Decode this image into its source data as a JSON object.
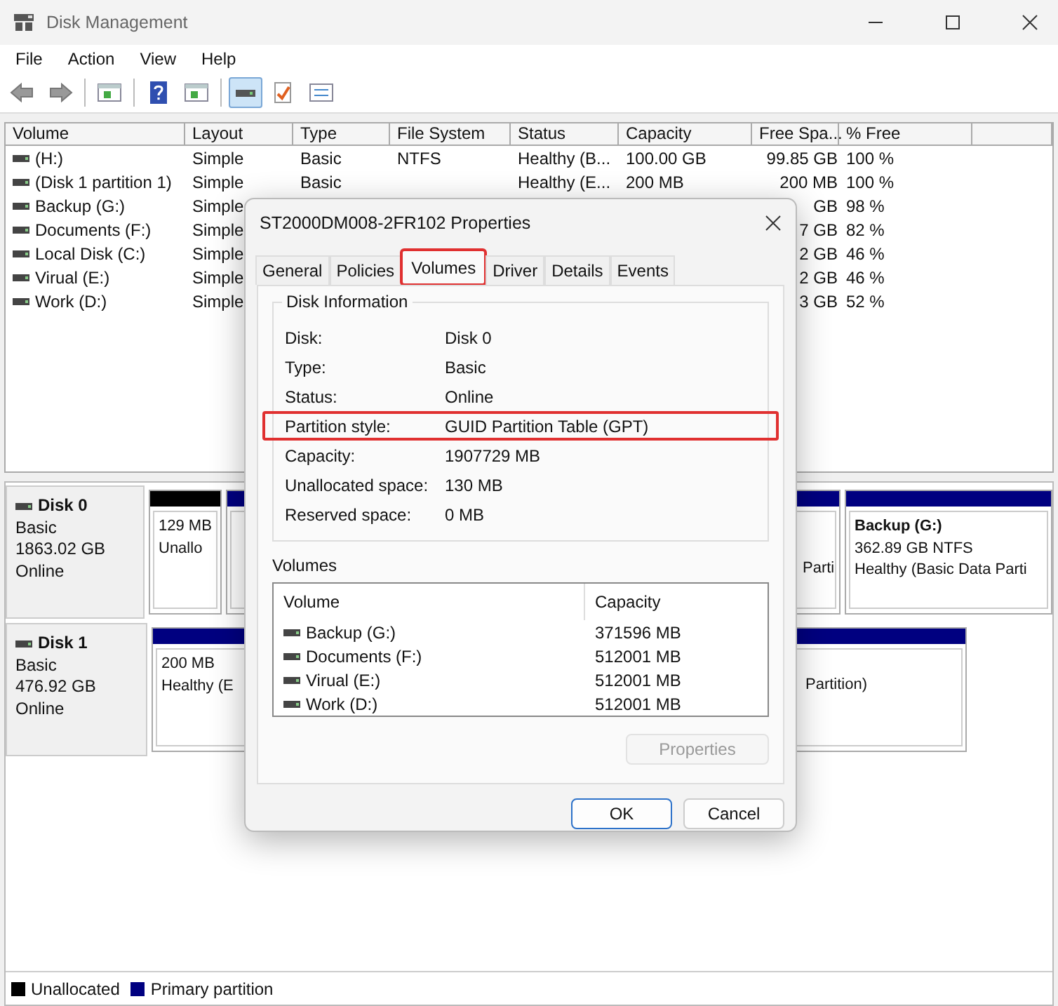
{
  "window": {
    "title": "Disk Management"
  },
  "menu": [
    "File",
    "Action",
    "View",
    "Help"
  ],
  "toolbar": [
    {
      "kind": "back",
      "selected": false
    },
    {
      "kind": "forward",
      "selected": false
    },
    {
      "kind": "sep"
    },
    {
      "kind": "pane",
      "selected": false
    },
    {
      "kind": "sep"
    },
    {
      "kind": "help",
      "selected": false
    },
    {
      "kind": "pane2",
      "selected": false
    },
    {
      "kind": "sep"
    },
    {
      "kind": "drive",
      "selected": true
    },
    {
      "kind": "check",
      "selected": false
    },
    {
      "kind": "list",
      "selected": false
    }
  ],
  "volume_table": {
    "columns": [
      "Volume",
      "Layout",
      "Type",
      "File System",
      "Status",
      "Capacity",
      "Free Spa...",
      "% Free"
    ],
    "rows": [
      {
        "cells": [
          " (H:)",
          "Simple",
          "Basic",
          "NTFS",
          "Healthy (B...",
          "100.00 GB",
          "99.85 GB",
          "100 %"
        ]
      },
      {
        "cells": [
          "(Disk 1 partition 1)",
          "Simple",
          "Basic",
          "",
          "Healthy (E...",
          "200 MB",
          "200 MB",
          "100 %"
        ]
      },
      {
        "cells": [
          "Backup (G:)",
          "Simple",
          "",
          "",
          "",
          "",
          "GB",
          "98 %"
        ]
      },
      {
        "cells": [
          "Documents (F:)",
          "Simple",
          "",
          "",
          "",
          "",
          "7 GB",
          "82 %"
        ]
      },
      {
        "cells": [
          "Local Disk (C:)",
          "Simple",
          "",
          "",
          "",
          "",
          "2 GB",
          "46 %"
        ]
      },
      {
        "cells": [
          "Virual (E:)",
          "Simple",
          "",
          "",
          "",
          "",
          "2 GB",
          "46 %"
        ]
      },
      {
        "cells": [
          "Work (D:)",
          "Simple",
          "",
          "",
          "",
          "",
          "3 GB",
          "52 %"
        ]
      }
    ]
  },
  "disks": [
    {
      "name": "Disk 0",
      "type": "Basic",
      "size": "1863.02 GB",
      "status": "Online",
      "partitions": [
        {
          "kind": "unallocated",
          "covered": false,
          "lines": [
            "129 MB",
            "Unallo"
          ]
        },
        {
          "kind": "primary",
          "covered": false
        },
        {
          "kind": "primary",
          "covered": true,
          "lines": [
            "Parti"
          ]
        },
        {
          "kind": "primary",
          "covered": false,
          "title": "Backup  (G:)",
          "lines": [
            "362.89 GB NTFS",
            "Healthy (Basic Data Parti"
          ]
        }
      ]
    },
    {
      "name": "Disk 1",
      "type": "Basic",
      "size": "476.92 GB",
      "status": "Online",
      "partitions": [
        {
          "kind": "primary",
          "covered": false,
          "lines": [
            "200 MB",
            "Healthy (E"
          ]
        },
        {
          "kind": "primary",
          "covered": true,
          "lines": [
            "Partition)"
          ]
        }
      ]
    }
  ],
  "legend": [
    {
      "label": "Unallocated",
      "color": "#000000"
    },
    {
      "label": "Primary partition",
      "color": "#000080"
    }
  ],
  "dialog": {
    "title": "ST2000DM008-2FR102 Properties",
    "tabs": [
      {
        "label": "General",
        "selected": false,
        "highlighted": false
      },
      {
        "label": "Policies",
        "selected": false,
        "highlighted": false
      },
      {
        "label": "Volumes",
        "selected": true,
        "highlighted": true
      },
      {
        "label": "Driver",
        "selected": false,
        "highlighted": false
      },
      {
        "label": "Details",
        "selected": false,
        "highlighted": false
      },
      {
        "label": "Events",
        "selected": false,
        "highlighted": false
      }
    ],
    "group_title": "Disk Information",
    "info": [
      {
        "label": "Disk:",
        "value": "Disk 0",
        "highlighted": false
      },
      {
        "label": "Type:",
        "value": "Basic",
        "highlighted": false
      },
      {
        "label": "Status:",
        "value": "Online",
        "highlighted": false
      },
      {
        "label": "Partition style:",
        "value": "GUID Partition Table (GPT)",
        "highlighted": true
      },
      {
        "label": "Capacity:",
        "value": "1907729 MB",
        "highlighted": false
      },
      {
        "label": "Unallocated space:",
        "value": "130 MB",
        "highlighted": false
      },
      {
        "label": "Reserved space:",
        "value": "0 MB",
        "highlighted": false
      }
    ],
    "volumes_label": "Volumes",
    "volumes_columns": [
      "Volume",
      "Capacity"
    ],
    "volumes": [
      {
        "name": "Backup (G:)",
        "capacity": "371596 MB"
      },
      {
        "name": "Documents (F:)",
        "capacity": "512001 MB"
      },
      {
        "name": "Virual (E:)",
        "capacity": "512001 MB"
      },
      {
        "name": "Work (D:)",
        "capacity": "512001 MB"
      }
    ],
    "properties_button": {
      "label": "Properties",
      "disabled": true
    },
    "buttons": [
      {
        "label": "OK",
        "default": true
      },
      {
        "label": "Cancel",
        "default": false
      }
    ]
  }
}
